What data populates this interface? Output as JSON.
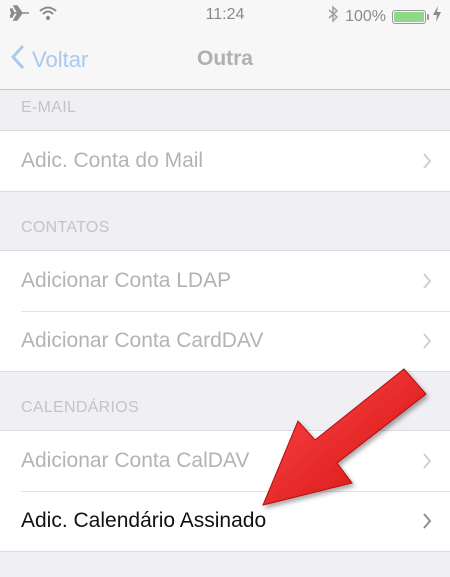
{
  "status_bar": {
    "time": "11:24",
    "battery_percent": "100%",
    "battery_level": 1.0,
    "icons": [
      "airplane-icon",
      "wifi-icon",
      "bluetooth-icon",
      "battery-icon",
      "charging-icon"
    ]
  },
  "nav": {
    "back_label": "Voltar",
    "title": "Outra"
  },
  "sections": [
    {
      "header": "E-MAIL",
      "items": [
        {
          "label": "Adic. Conta do Mail"
        }
      ]
    },
    {
      "header": "CONTATOS",
      "items": [
        {
          "label": "Adicionar Conta LDAP"
        },
        {
          "label": "Adicionar Conta CardDAV"
        }
      ]
    },
    {
      "header": "CALENDÁRIOS",
      "items": [
        {
          "label": "Adicionar Conta CalDAV"
        },
        {
          "label": "Adic. Calendário Assinado"
        }
      ]
    }
  ],
  "colors": {
    "background": "#efeff4",
    "accent": "#a9c9ee",
    "annotation_arrow": "#e41e1e"
  }
}
